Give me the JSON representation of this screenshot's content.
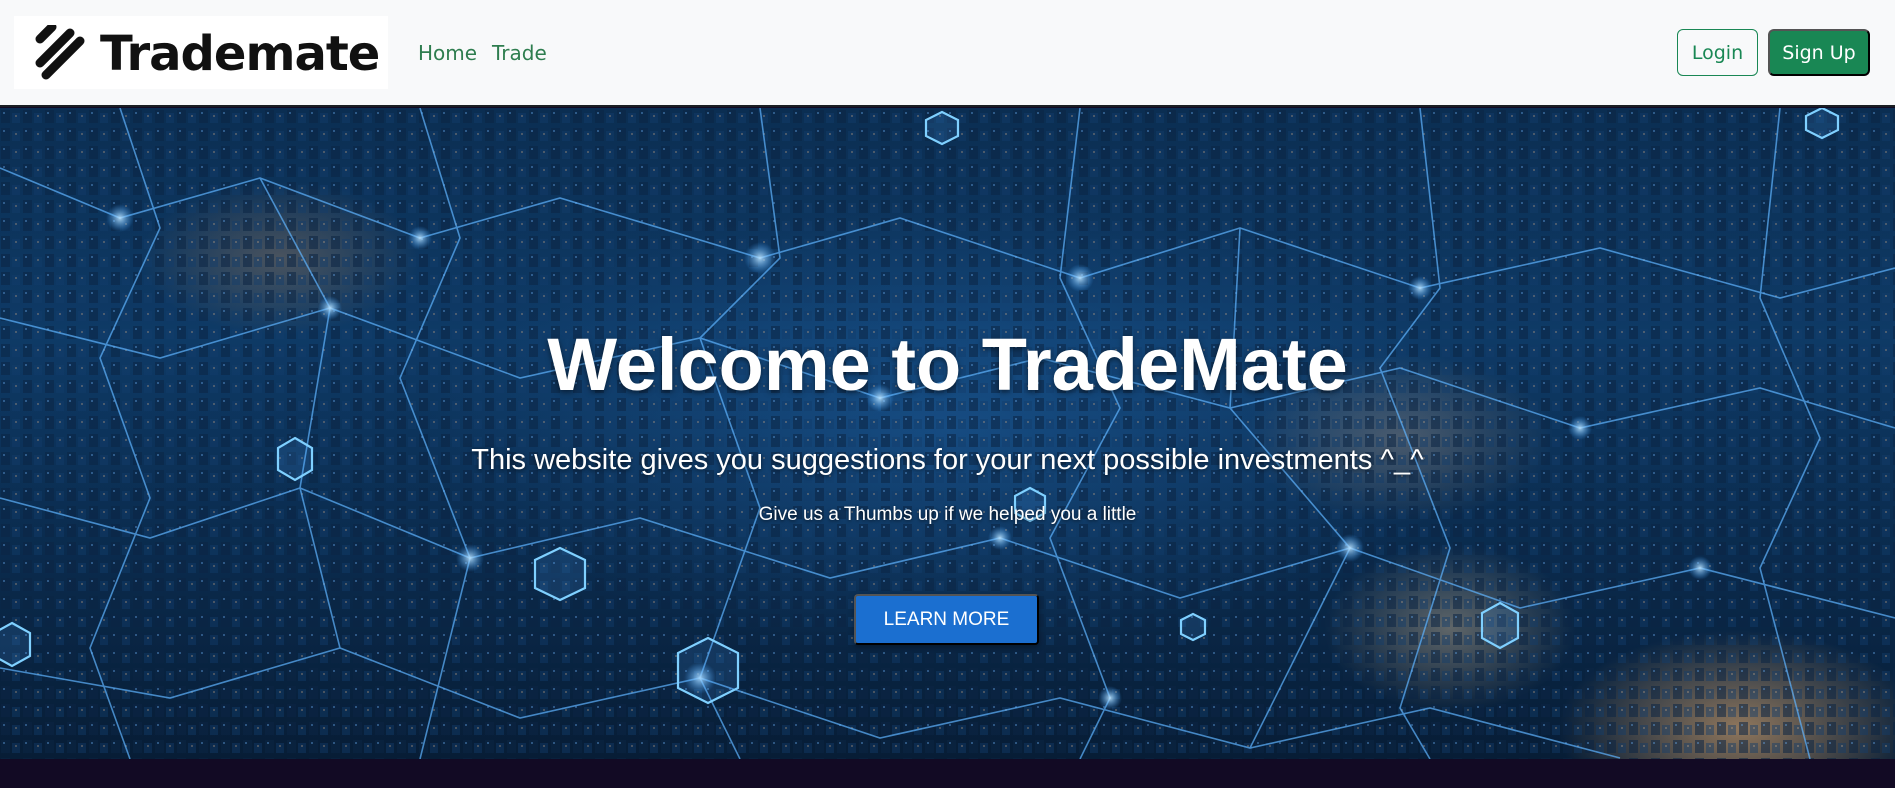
{
  "navbar": {
    "logo_text": "Trademate",
    "links": [
      {
        "label": "Home"
      },
      {
        "label": "Trade"
      }
    ],
    "login_label": "Login",
    "signup_label": "Sign Up"
  },
  "hero": {
    "title": "Welcome to TradeMate",
    "subtitle": "This website gives you suggestions for your next possible investments ^_^",
    "tagline": "Give us a Thumbs up if we helped you a little",
    "cta_label": "LEARN MORE"
  },
  "colors": {
    "accent_green": "#198754",
    "nav_link_green": "#2e7d4f",
    "cta_blue": "#1b6fd0",
    "footer_dark": "#120a24"
  },
  "icons": {
    "logo": "trademate-slashes-logo-icon"
  }
}
